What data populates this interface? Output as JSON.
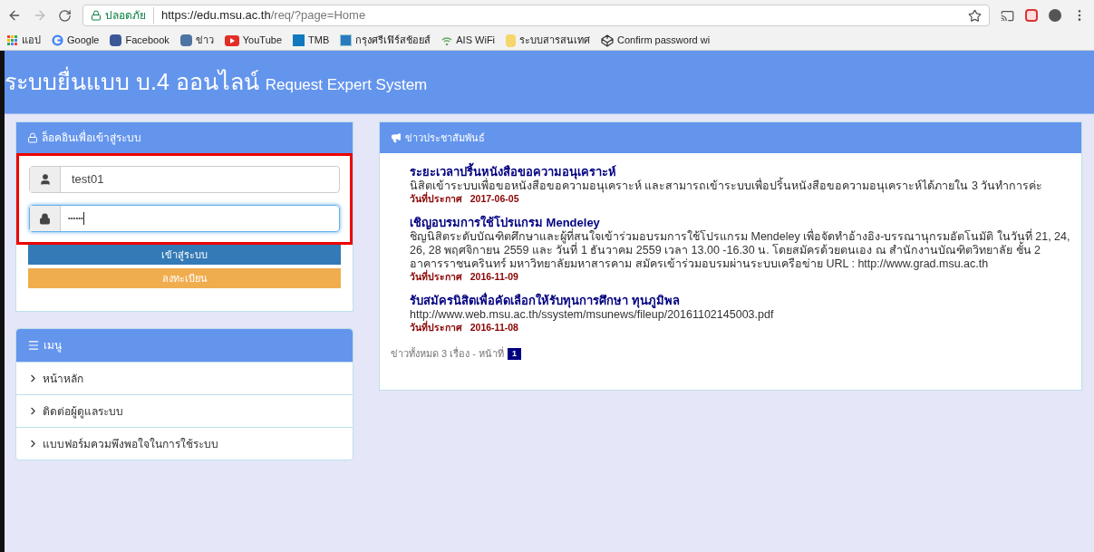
{
  "browser": {
    "security": "ปลอดภัย",
    "url_host": "https://edu.msu.ac.th",
    "url_path": "/req/?page=Home",
    "bookmarks": [
      "แอป",
      "Google",
      "Facebook",
      "ข่าว",
      "YouTube",
      "TMB",
      "กรุงศรีเฟิร์สช้อยส์",
      "AIS WiFi",
      "ระบบสารสนเทศ",
      "Confirm password wi"
    ]
  },
  "header": {
    "title": "ระบบยื่นแบบ บ.4 ออนไลน์",
    "subtitle": "Request Expert System"
  },
  "login": {
    "title": "ล็อคอินเพื่อเข้าสู่ระบบ",
    "username": "test01",
    "password": "••••••",
    "login_button": "เข้าสู่ระบบ",
    "register_button": "ลงทะเบียน"
  },
  "menu": {
    "title": "เมนู",
    "items": [
      "หน้าหลัก",
      "ติดต่อผู้ดูแลระบบ",
      "แบบฟอร์มควมพึงพอใจในการใช้ระบบ"
    ]
  },
  "news": {
    "title": "ข่าวประชาสัมพันธ์",
    "items": [
      {
        "headline": "ระยะเวลาปริ้นหนังสือขอความอนุเคราะห์",
        "body": "นิสิตเข้าระบบเพื่อขอหนังสือขอความอนุเคราะห์ และสามารถเข้าระบบเพื่อปริ้นหนังสือขอความอนุเคราะห์ได้ภายใน 3 วันทำการค่ะ",
        "date_label": "วันที่ประกาศ",
        "date": "2017-06-05"
      },
      {
        "headline": "เชิญอบรมการใช้โปรแกรม Mendeley",
        "body": "ชิญนิสิตระดับบัณฑิตศึกษาและผู้ที่สนใจเข้าร่วมอบรมการใช้โปรแกรม Mendeley เพื่อจัดทำอ้างอิง-บรรณานุกรมอัตโนมัติ ในวันที่ 21, 24, 26, 28 พฤศจิกายน 2559 และ วันที่ 1 ธันวาคม 2559 เวลา 13.00 -16.30 น. โดยสมัครด้วยตนเอง ณ สำนักงานบัณฑิตวิทยาลัย ชั้น 2 อาคารราชนครินทร์ มหาวิทยาลัยมหาสารคาม สมัครเข้าร่วมอบรมผ่านระบบเครือข่าย URL : http://www.grad.msu.ac.th",
        "date_label": "วันที่ประกาศ",
        "date": "2016-11-09"
      },
      {
        "headline": "รับสมัครนิสิตเพื่อคัดเลือกให้รับทุนการศึกษา ทุนภูมิพล",
        "body": "http://www.web.msu.ac.th/ssystem/msunews/fileup/20161102145003.pdf",
        "date_label": "วันที่ประกาศ",
        "date": "2016-11-08"
      }
    ],
    "summary": "ข่าวทั้งหมด 3 เรื่อง - หน้าที่",
    "pages": [
      {
        "label": "1",
        "selected": true
      }
    ]
  }
}
